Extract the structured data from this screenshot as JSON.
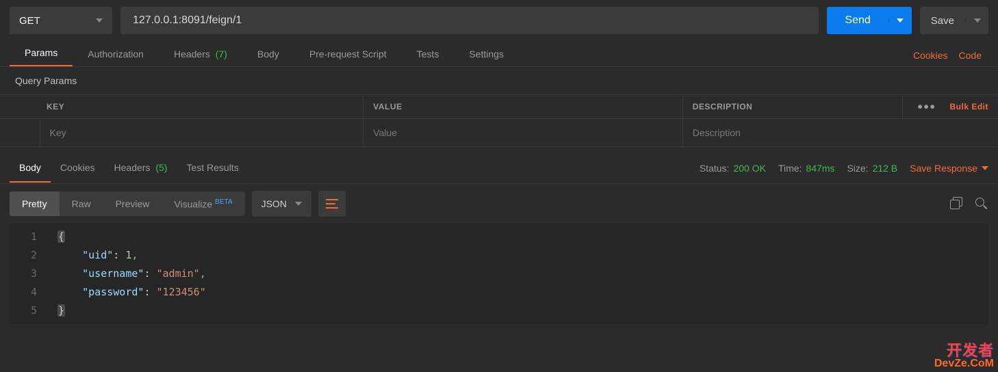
{
  "request": {
    "method": "GET",
    "url": "127.0.0.1:8091/feign/1",
    "send_label": "Send",
    "save_label": "Save"
  },
  "req_tabs": {
    "items": [
      "Params",
      "Authorization",
      "Headers",
      "Body",
      "Pre-request Script",
      "Tests",
      "Settings"
    ],
    "headers_count": "(7)",
    "cookies_link": "Cookies",
    "code_link": "Code"
  },
  "section_title": "Query Params",
  "params_table": {
    "cols": {
      "key": "KEY",
      "value": "VALUE",
      "desc": "DESCRIPTION"
    },
    "placeholders": {
      "key": "Key",
      "value": "Value",
      "desc": "Description"
    },
    "bulk_edit": "Bulk Edit"
  },
  "response_tabs": {
    "items": [
      "Body",
      "Cookies",
      "Headers",
      "Test Results"
    ],
    "headers_count": "(5)"
  },
  "meta": {
    "status_label": "Status:",
    "status_value": "200 OK",
    "time_label": "Time:",
    "time_value": "847ms",
    "size_label": "Size:",
    "size_value": "212 B",
    "save_response": "Save Response"
  },
  "body_toolbar": {
    "modes": [
      "Pretty",
      "Raw",
      "Preview",
      "Visualize"
    ],
    "beta": "BETA",
    "lang": "JSON"
  },
  "response_body": {
    "uid": 1,
    "username": "admin",
    "password": "123456"
  },
  "code_lines": [
    {
      "n": "1",
      "html": "<span class=\"punct\">{</span>"
    },
    {
      "n": "2",
      "html": "    <span class=\"key\">\"uid\"</span><span class=\"colon\">:</span> <span class=\"num\">1</span>,"
    },
    {
      "n": "3",
      "html": "    <span class=\"key\">\"username\"</span><span class=\"colon\">:</span> <span class=\"str\">\"admin\"</span>,"
    },
    {
      "n": "4",
      "html": "    <span class=\"key\">\"password\"</span><span class=\"colon\">:</span> <span class=\"str\">\"123456\"</span>"
    },
    {
      "n": "5",
      "html": "<span class=\"punct\">}</span>"
    }
  ],
  "watermark": {
    "line1": "开发者",
    "line2": "DevZe.CoM"
  }
}
